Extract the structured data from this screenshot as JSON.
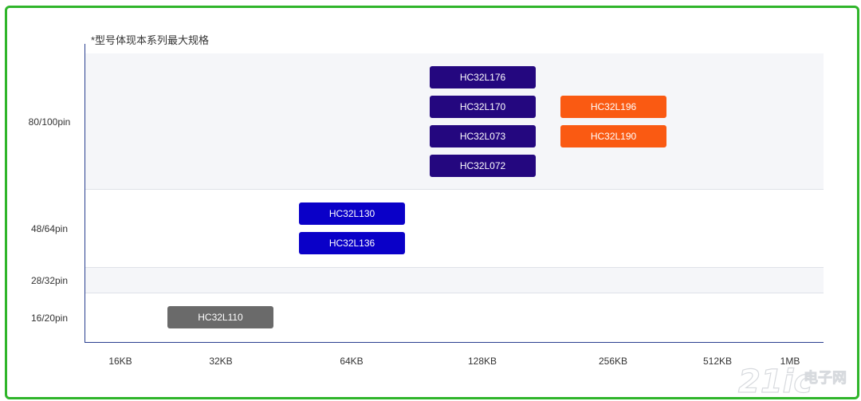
{
  "note": "*型号体现本系列最大规格",
  "y_labels": [
    "80/100pin",
    "48/64pin",
    "28/32pin",
    "16/20pin"
  ],
  "x_labels": [
    "16KB",
    "32KB",
    "64KB",
    "128KB",
    "256KB",
    "512KB",
    "1MB"
  ],
  "chips": {
    "hc32l176": "HC32L176",
    "hc32l170": "HC32L170",
    "hc32l073": "HC32L073",
    "hc32l072": "HC32L072",
    "hc32l196": "HC32L196",
    "hc32l190": "HC32L190",
    "hc32l130": "HC32L130",
    "hc32l136": "HC32L136",
    "hc32l110": "HC32L110"
  },
  "watermark": "21ic电子网",
  "colors": {
    "frame": "#2fb52a",
    "navy": "#24077f",
    "orange": "#fa5a12",
    "blue": "#0a00c8",
    "gray": "#6a6a6a",
    "axis": "#2a3f8f"
  }
}
